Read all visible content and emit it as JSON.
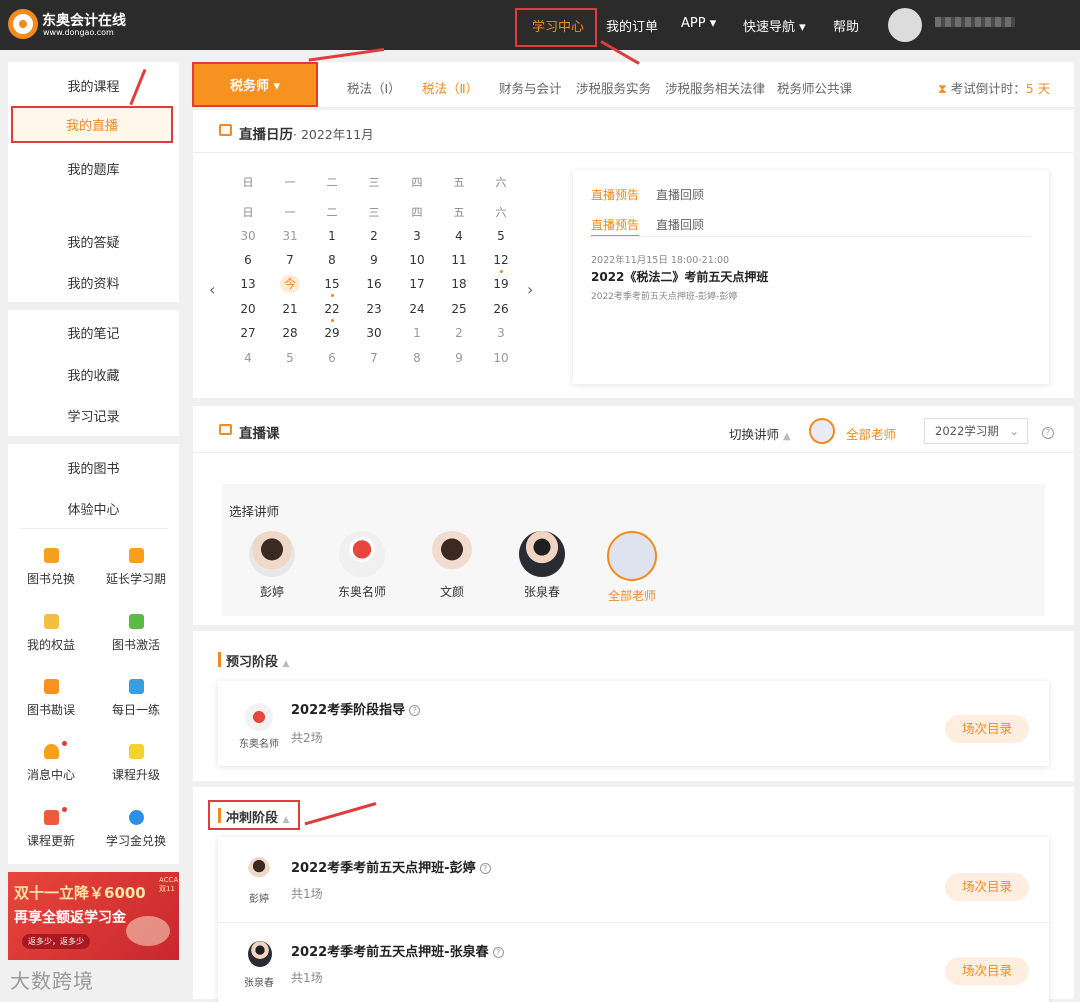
{
  "topbar": {
    "brand": "东奥会计在线",
    "brand_url": "www.dongao.com",
    "nav": [
      "学习中心",
      "我的订单",
      "APP ▾",
      "快速导航 ▾",
      "帮助"
    ],
    "user_name": "",
    "accent": "#f28a1e"
  },
  "sidebar": {
    "group1": [
      "我的课程",
      "我的直播",
      "我的题库",
      "我的答疑",
      "我的资料"
    ],
    "group2": [
      "我的笔记",
      "我的收藏",
      "学习记录"
    ],
    "group3": [
      "我的图书",
      "体验中心"
    ],
    "grid": [
      "图书兑换",
      "延长学习期",
      "我的权益",
      "图书激活",
      "图书勘误",
      "每日一练",
      "消息中心",
      "课程升级",
      "课程更新",
      "学习金兑换"
    ],
    "banner_line1": "双十一立降￥6000",
    "banner_line2": "再享全额返学习金",
    "banner_tag": "ACCA 双11",
    "banner_btn": "返多少，返多少",
    "watermark": "大数跨境"
  },
  "subject": {
    "current": "税务师 ▾",
    "tabs": [
      "税法（Ⅰ）",
      "税法（Ⅱ）",
      "财务与会计",
      "涉税服务实务",
      "涉税服务相关法律",
      "税务师公共课"
    ],
    "active_tab": 1,
    "countdown_label": "考试倒计时：",
    "countdown_value": "5 天"
  },
  "calendar": {
    "title": "直播日历",
    "month": "· 2022年11月",
    "weekdays": [
      "日",
      "一",
      "二",
      "三",
      "四",
      "五",
      "六"
    ],
    "weeks": [
      [
        "30",
        "31",
        "1",
        "2",
        "3",
        "4",
        "5"
      ],
      [
        "6",
        "7",
        "8",
        "9",
        "10",
        "11",
        "12"
      ],
      [
        "13",
        "今",
        "15",
        "16",
        "17",
        "18",
        "19"
      ],
      [
        "20",
        "21",
        "22",
        "23",
        "24",
        "25",
        "26"
      ],
      [
        "27",
        "28",
        "29",
        "30",
        "1",
        "2",
        "3"
      ],
      [
        "4",
        "5",
        "6",
        "7",
        "8",
        "9",
        "10"
      ]
    ],
    "today_label": "今",
    "dot_dates": [
      "12",
      "15",
      "22"
    ],
    "card_tabs": [
      "直播预告",
      "直播回顾"
    ],
    "event": {
      "time": "2022年11月15日 18:00-21:00",
      "title": "2022《税法二》考前五天点押班",
      "subtitle": "2022考季考前五天点押班-彭婷-彭婷"
    }
  },
  "live_course": {
    "title": "直播课",
    "switch_label": "切换讲师",
    "current_teacher": "全部老师",
    "period_select": "2022学习期",
    "select_label": "选择讲师",
    "teachers": [
      "彭婷",
      "东奥名师",
      "文颜",
      "张泉春",
      "全部老师"
    ]
  },
  "stages": [
    {
      "name": "预习阶段",
      "items": [
        {
          "teacher": "东奥名师",
          "title": "2022考季阶段指导",
          "count": "共2场",
          "button": "场次目录"
        }
      ]
    },
    {
      "name": "冲刺阶段",
      "items": [
        {
          "teacher": "彭婷",
          "title": "2022考季考前五天点押班-彭婷",
          "count": "共1场",
          "button": "场次目录"
        },
        {
          "teacher": "张泉春",
          "title": "2022考季考前五天点押班-张泉春",
          "count": "共1场",
          "button": "场次目录"
        }
      ]
    }
  ]
}
